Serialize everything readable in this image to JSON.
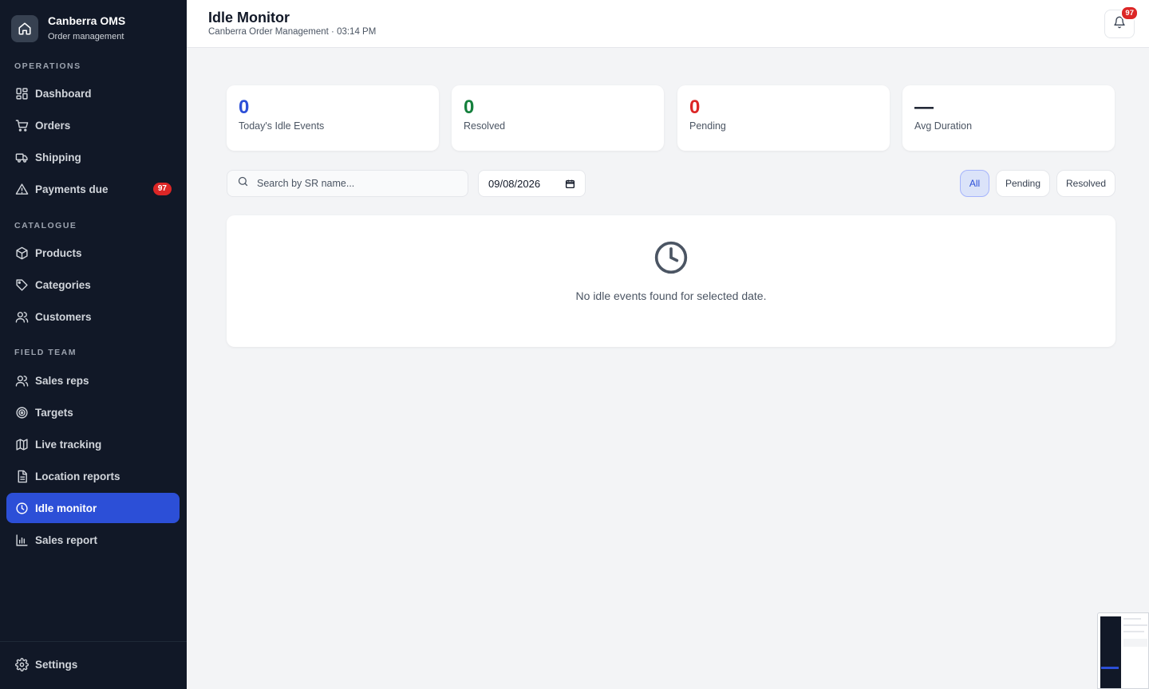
{
  "brand": {
    "title": "Canberra OMS",
    "subtitle": "Order management"
  },
  "sidebar": {
    "sections": [
      {
        "title": "OPERATIONS"
      },
      {
        "title": "CATALOGUE"
      },
      {
        "title": "FIELD TEAM"
      }
    ],
    "items": [
      {
        "label": "Dashboard",
        "icon": "grid-icon"
      },
      {
        "label": "Orders",
        "icon": "cart-icon"
      },
      {
        "label": "Shipping",
        "icon": "truck-icon"
      },
      {
        "label": "Payments due",
        "icon": "warning-icon",
        "badge": "97"
      },
      {
        "label": "Products",
        "icon": "box-icon"
      },
      {
        "label": "Categories",
        "icon": "tag-icon"
      },
      {
        "label": "Customers",
        "icon": "users-icon"
      },
      {
        "label": "Sales reps",
        "icon": "users-icon"
      },
      {
        "label": "Targets",
        "icon": "target-icon"
      },
      {
        "label": "Live tracking",
        "icon": "map-icon"
      },
      {
        "label": "Location reports",
        "icon": "document-icon"
      },
      {
        "label": "Idle monitor",
        "icon": "clock-icon",
        "active": true
      },
      {
        "label": "Sales report",
        "icon": "bar-chart-icon"
      }
    ],
    "settings": {
      "label": "Settings",
      "icon": "gear-icon"
    }
  },
  "header": {
    "title": "Idle Monitor",
    "subtitle": "Canberra Order Management · 03:14 PM",
    "notification_count": "97"
  },
  "stats": [
    {
      "value": "0",
      "label": "Today's Idle Events",
      "color": "#2c4fd7"
    },
    {
      "value": "0",
      "label": "Resolved",
      "color": "#15803d"
    },
    {
      "value": "0",
      "label": "Pending",
      "color": "#dc2626"
    },
    {
      "value": "—",
      "label": "Avg Duration",
      "color": "#111827"
    }
  ],
  "filters": {
    "search_placeholder": "Search by SR name...",
    "date": "09/08/2026",
    "status_buttons": [
      {
        "label": "All",
        "active": true
      },
      {
        "label": "Pending",
        "active": false
      },
      {
        "label": "Resolved",
        "active": false
      }
    ]
  },
  "empty_state": {
    "message": "No idle events found for selected date."
  },
  "colors": {
    "sidebar_bg": "#111827",
    "accent": "#2c4fd7",
    "badge": "#dc2626"
  }
}
